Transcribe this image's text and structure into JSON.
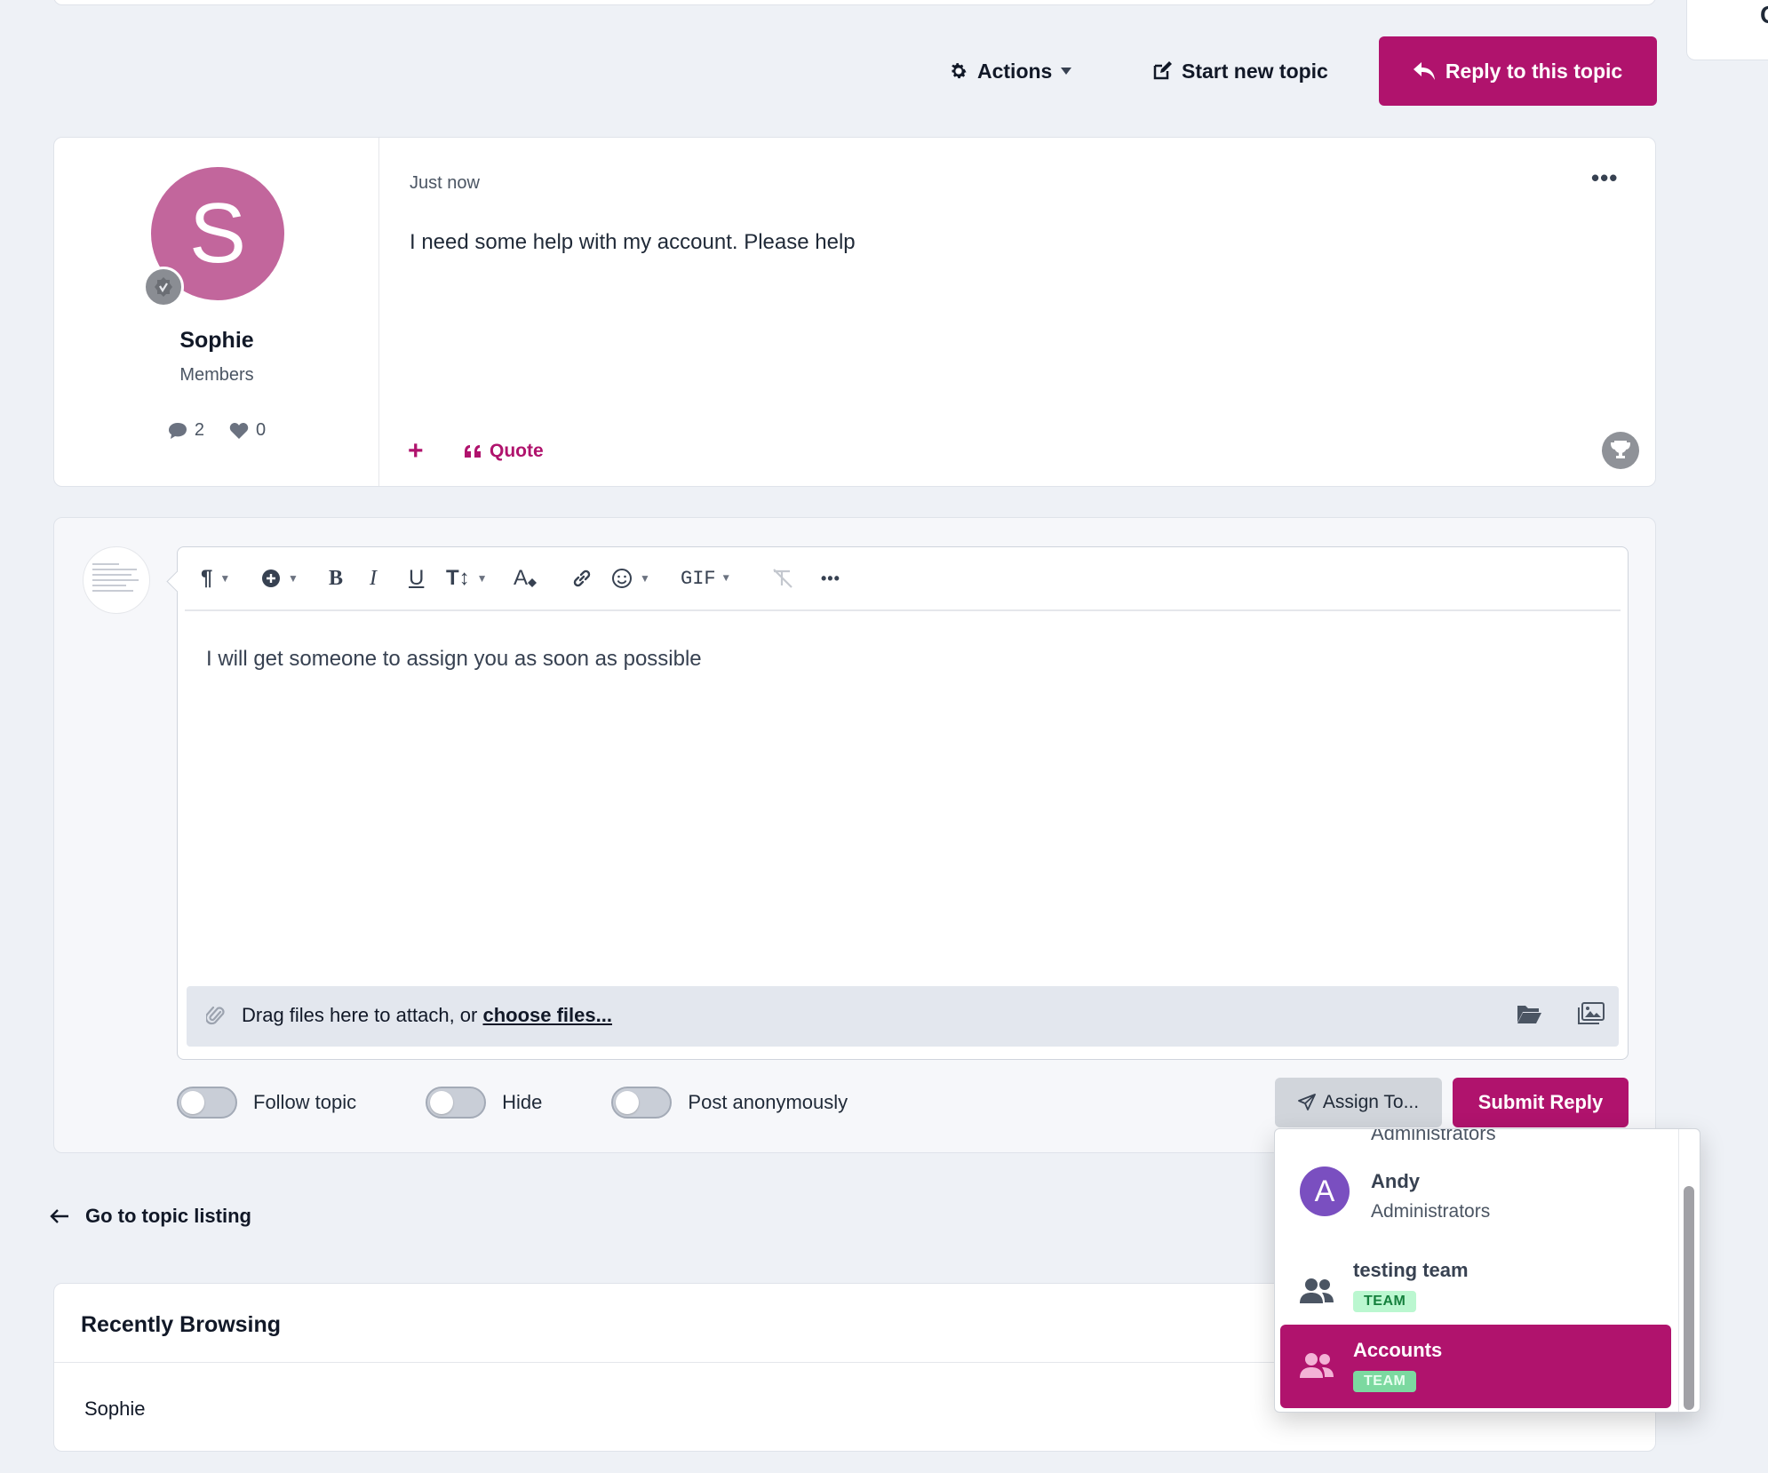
{
  "top": {
    "side_char": "C"
  },
  "topbar": {
    "actions_label": "Actions",
    "start_new_topic_label": "Start new topic",
    "reply_label": "Reply to this topic"
  },
  "post": {
    "author": {
      "initial": "S",
      "name": "Sophie",
      "group": "Members",
      "posts_count": "2",
      "reactions_count": "0"
    },
    "time": "Just now",
    "more": "•••",
    "content": "I need some help with my account. Please help",
    "add_label": "+",
    "quote_label": "Quote"
  },
  "editor": {
    "toolbar": {
      "bold": "B",
      "italic": "I",
      "underline": "U",
      "size": "T↕",
      "color": "A",
      "gif": "GIF",
      "more": "•••"
    },
    "content": "I will get someone to assign you as soon as possible",
    "dropzone": {
      "text": "Drag files here to attach, or ",
      "link": "choose files..."
    }
  },
  "options": {
    "follow_label": "Follow topic",
    "hide_label": "Hide",
    "anon_label": "Post anonymously"
  },
  "buttons": {
    "assign_label": "Assign To...",
    "submit_label": "Submit Reply"
  },
  "nav": {
    "go_to_listing": "Go to topic listing"
  },
  "recent": {
    "title": "Recently Browsing",
    "users": [
      "Sophie"
    ]
  },
  "assign_dropdown": {
    "cut_item": "Administrators",
    "items": [
      {
        "initial": "A",
        "name": "Andy",
        "sub": "Administrators"
      },
      {
        "name": "testing team",
        "badge": "TEAM"
      },
      {
        "name": "Accounts",
        "badge": "TEAM",
        "selected": true
      }
    ]
  },
  "colors": {
    "accent": "#b0136d",
    "avatar_s": "#c2669c",
    "avatar_a": "#7a4fc0",
    "team_badge": "#bbf7d0"
  }
}
